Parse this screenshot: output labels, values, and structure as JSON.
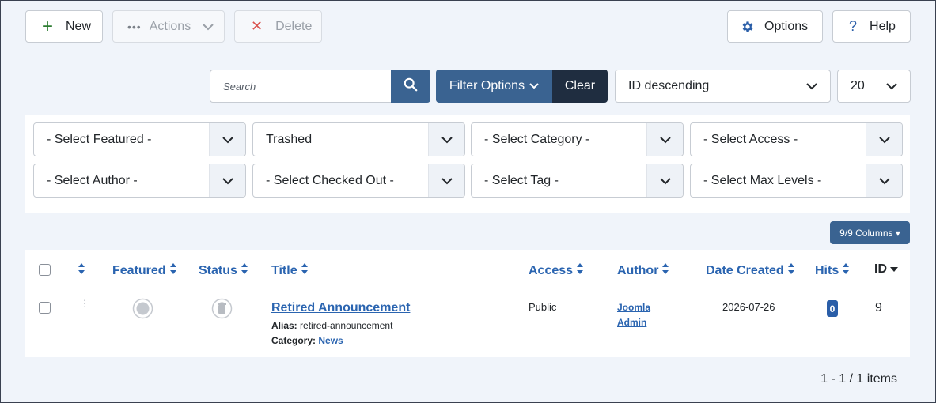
{
  "toolbar": {
    "new_label": "New",
    "actions_label": "Actions",
    "delete_label": "Delete",
    "options_label": "Options",
    "help_label": "Help"
  },
  "search": {
    "placeholder": "Search",
    "value": ""
  },
  "filter_bar": {
    "filter_options_label": "Filter Options",
    "clear_label": "Clear",
    "ordering_value": "ID descending",
    "limit_value": "20"
  },
  "filters": {
    "featured": "- Select Featured -",
    "status": "Trashed",
    "category": "- Select Category -",
    "access": "- Select Access -",
    "author": "- Select Author -",
    "checked_out": "- Select Checked Out -",
    "tag": "- Select Tag -",
    "max_levels": "- Select Max Levels -"
  },
  "columns_button_label": "9/9 Columns ▾",
  "table": {
    "headers": {
      "featured": "Featured",
      "status": "Status",
      "title": "Title",
      "access": "Access",
      "author": "Author",
      "date_created": "Date Created",
      "hits": "Hits",
      "id": "ID"
    },
    "rows": [
      {
        "title": "Retired Announcement",
        "alias_label": "Alias:",
        "alias": "retired-announcement",
        "category_label": "Category:",
        "category": "News",
        "access": "Public",
        "author_line1": "Joomla",
        "author_line2": "Admin",
        "date_created": "2026-07-26",
        "hits": "0",
        "id": "9"
      }
    ]
  },
  "pagination_info": "1 - 1 / 1 items",
  "colors": {
    "accent": "#3a6391",
    "link": "#2a64b0",
    "clear_button": "#1f2d40",
    "new_plus": "#2e7d32",
    "delete_x": "#d9534f"
  },
  "icons": {
    "new": "plus-icon",
    "actions": "ellipsis-icon",
    "delete": "x-icon",
    "options": "gear-icon",
    "help": "question-icon",
    "search": "search-icon"
  }
}
